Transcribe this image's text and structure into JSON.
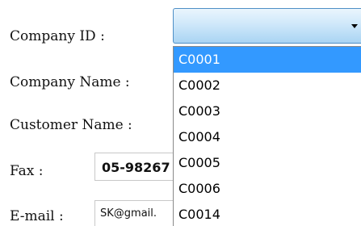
{
  "form": {
    "company_id_label": "Company ID :",
    "company_name_label": "Company Name :",
    "customer_name_label": "Customer Name :",
    "fax_label": "Fax :",
    "email_label": "E-mail :",
    "fax_value": "05-98267",
    "email_value": "SK@gmail."
  },
  "company_select": {
    "selected_value": "",
    "arrow_icon": "triangle-down-icon",
    "options": [
      "C0001",
      "C0002",
      "C0003",
      "C0004",
      "C0005",
      "C0006",
      "C0014"
    ],
    "highlighted_index": 0
  },
  "colors": {
    "highlight": "#3399ff",
    "select_border": "#4e8fc6"
  }
}
